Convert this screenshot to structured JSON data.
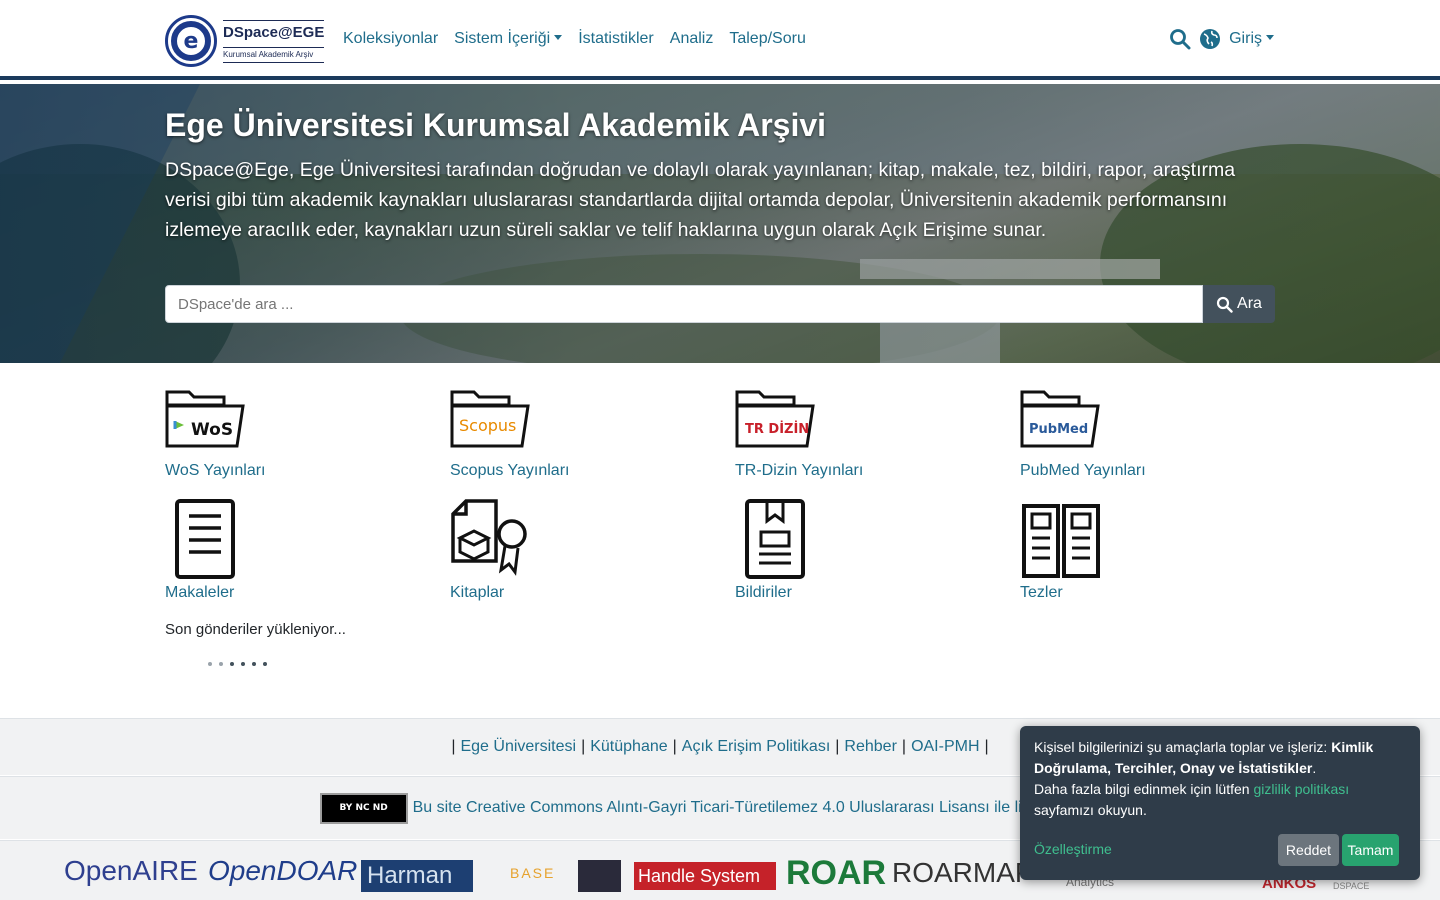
{
  "header": {
    "logo_title": "DSpace@EGE",
    "logo_subtitle": "Kurumsal Akademik Arşiv",
    "logo_letter": "e",
    "nav": [
      {
        "label": "Koleksiyonlar"
      },
      {
        "label": "Sistem İçeriği"
      },
      {
        "label": "İstatistikler"
      },
      {
        "label": "Analiz"
      },
      {
        "label": "Talep/Soru"
      }
    ],
    "login_label": "Giriş"
  },
  "hero": {
    "title": "Ege Üniversitesi Kurumsal Akademik Arşivi",
    "description": "DSpace@Ege, Ege Üniversitesi tarafından doğrudan ve dolaylı olarak yayınlanan; kitap, makale, tez, bildiri, rapor, araştırma verisi gibi tüm akademik kaynakları uluslararası standartlarda dijital ortamda depolar, Üniversitenin akademik performansını izlemeye aracılık eder, kaynakları uzun süreli saklar ve telif haklarına uygun olarak Açık Erişime sunar.",
    "search_placeholder": "DSpace'de ara ...",
    "search_button": "Ara"
  },
  "categories": [
    {
      "label": "WoS Yayınları",
      "icon_text": "WoS"
    },
    {
      "label": "Scopus Yayınları",
      "icon_text": "Scopus"
    },
    {
      "label": "TR-Dizin Yayınları",
      "icon_text": "TR DİZİN"
    },
    {
      "label": "PubMed Yayınları",
      "icon_text": "PubMed"
    },
    {
      "label": "Makaleler"
    },
    {
      "label": "Kitaplar"
    },
    {
      "label": "Bildiriler"
    },
    {
      "label": "Tezler"
    }
  ],
  "loading_text": "Son gönderiler yükleniyor...",
  "footer": {
    "links": [
      "Ege Üniversitesi",
      "Kütüphane",
      "Açık Erişim Politikası",
      "Rehber",
      "OAI-PMH"
    ],
    "cc_badge": "BY NC ND",
    "cc_text": "Bu site Creative Commons Alıntı-Gayri Ticari-Türetilemez 4.0 Uluslararası Lisansı ile lisanslanmıştır.",
    "logos": [
      "OpenAIRE",
      "OpenDOAR",
      "Harman",
      "BASE",
      "Handle System",
      "ROAR",
      "ROARMAP",
      "Analytics",
      "ANKOS",
      "DSPACE"
    ]
  },
  "cookie": {
    "text_prefix": "Kişisel bilgilerinizi şu amaçlarla toplar ve işleriz: ",
    "purposes": "Kimlik Doğrulama, Tercihler, Onay ve İstatistikler",
    "text_suffix": ".",
    "more_prefix": "Daha fazla bilgi edinmek için lütfen ",
    "policy_link": "gizlilik politikası",
    "more_suffix": " sayfamızı okuyun.",
    "customize": "Özelleştirme",
    "reject": "Reddet",
    "accept": "Tamam"
  },
  "colors": {
    "link": "#1f6d8b",
    "header_border": "#1b3a5c",
    "cookie_bg": "#2f3c49",
    "accept": "#28a36f"
  }
}
